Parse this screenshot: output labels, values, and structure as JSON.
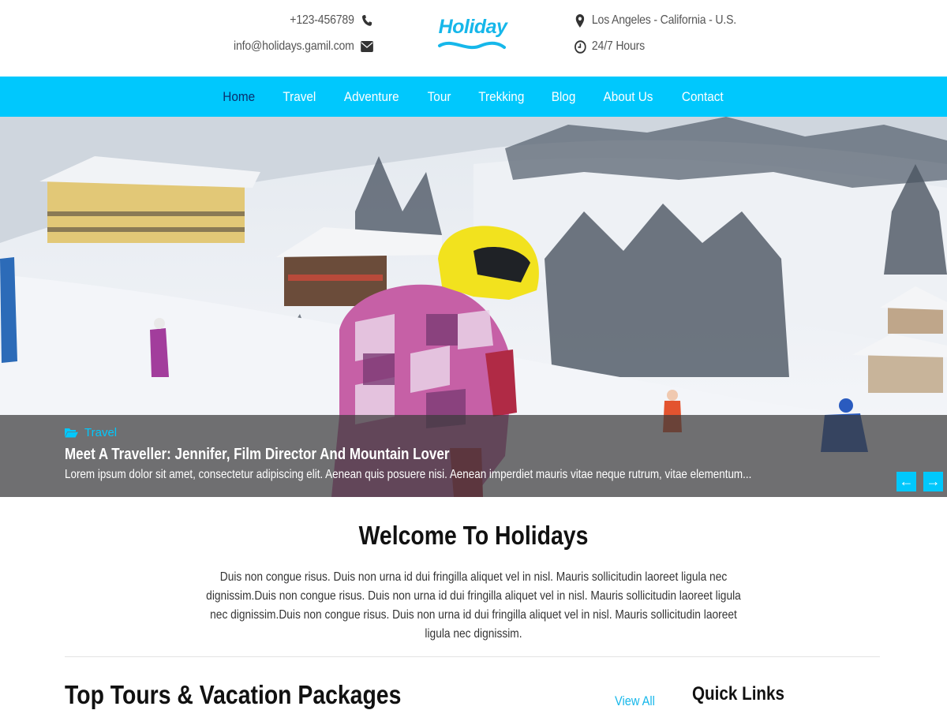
{
  "header": {
    "phone": "+123-456789",
    "email": "info@holidays.gamil.com",
    "location": "Los Angeles - California - U.S.",
    "hours": "24/7 Hours",
    "logo_text": "Holiday",
    "brand_color": "#16b7ea"
  },
  "nav": {
    "color": "#00c8fd",
    "items": [
      {
        "label": "Home",
        "active": true
      },
      {
        "label": "Travel"
      },
      {
        "label": "Adventure"
      },
      {
        "label": "Tour"
      },
      {
        "label": "Trekking"
      },
      {
        "label": "Blog"
      },
      {
        "label": "About Us"
      },
      {
        "label": "Contact"
      }
    ]
  },
  "slider": {
    "category": "Travel",
    "title": "Meet A Traveller: Jennifer, Film Director And Mountain Lover",
    "excerpt": "Lorem ipsum dolor sit amet, consectetur adipiscing elit. Aenean quis posuere nisi. Aenean imperdiet mauris vitae neque rutrum, vitae elementum...",
    "prev_icon": "arrow-left-icon",
    "next_icon": "arrow-right-icon",
    "prev_glyph": "←",
    "next_glyph": "→"
  },
  "welcome": {
    "title": "Welcome To Holidays",
    "text": "Duis non congue risus. Duis non urna id dui fringilla aliquet vel in nisl. Mauris sollicitudin laoreet ligula nec dignissim.Duis non congue risus. Duis non urna id dui fringilla aliquet vel in nisl. Mauris sollicitudin laoreet ligula nec dignissim.Duis non congue risus. Duis non urna id dui fringilla aliquet vel in nisl. Mauris sollicitudin laoreet ligula nec dignissim."
  },
  "packages": {
    "title": "Top Tours & Vacation Packages",
    "view_all": "View All"
  },
  "sidebar": {
    "quick_links_title": "Quick Links"
  }
}
